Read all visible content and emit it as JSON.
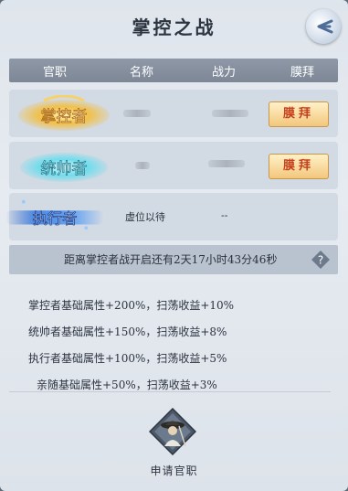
{
  "title": "掌控之战",
  "header": {
    "col_rank": "官职",
    "col_name": "名称",
    "col_power": "战力",
    "col_worship": "膜拜"
  },
  "rows": [
    {
      "rank": "掌控者",
      "name": "",
      "power": "",
      "action": "膜拜"
    },
    {
      "rank": "统帅者",
      "name": "",
      "power": "",
      "action": "膜拜"
    },
    {
      "rank": "执行者",
      "name": "虚位以待",
      "power": "--"
    }
  ],
  "countdown": "距离掌控者战开启还有2天17小时43分46秒",
  "benefits": [
    "掌控者基础属性+200%，扫荡收益+10%",
    "统帅者基础属性+150%，扫荡收益+8%",
    "执行者基础属性+100%，扫荡收益+5%",
    "亲随基础属性+50%，扫荡收益+3%"
  ],
  "apply_label": "申请官职",
  "colors": {
    "header_bg": "#868f9e",
    "worship_text": "#c6411d",
    "worship_bg": "#f6d8a0",
    "gold_badge": "#e8b23a",
    "cyan_badge": "#5fd6e8",
    "blue_badge": "#4a86d8"
  }
}
